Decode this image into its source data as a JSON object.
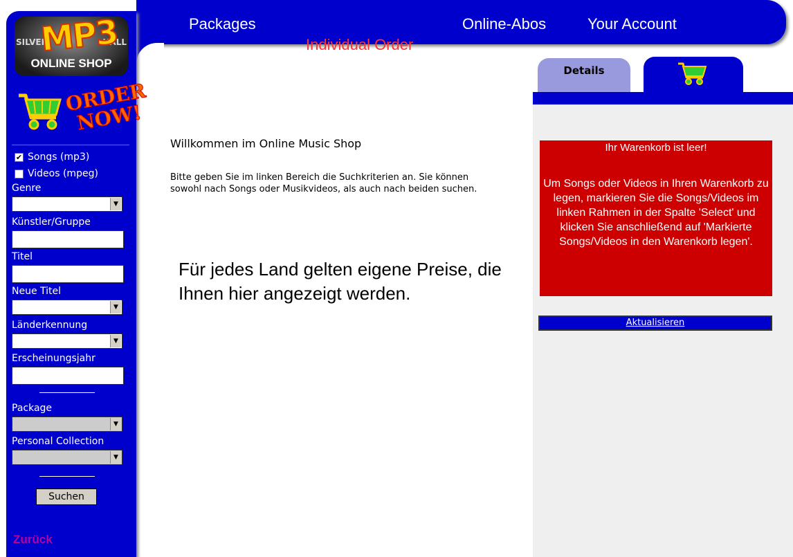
{
  "sidebar": {
    "logo": {
      "brand": "MP3",
      "silver_left": "SILVER",
      "silver_right": "HALL",
      "subtitle": "ONLINE SHOP"
    },
    "order_now": {
      "line1": "ORDER",
      "line2": "NOW!"
    },
    "checkboxes": [
      {
        "label": "Songs (mp3)",
        "checked": true
      },
      {
        "label": "Videos (mpeg)",
        "checked": false
      }
    ],
    "fields": {
      "genre": "Genre",
      "artist": "Künstler/Gruppe",
      "title": "Titel",
      "new_titles": "Neue Titel",
      "country_code": "Länderkennung",
      "release_year": "Erscheinungsjahr",
      "package": "Package",
      "personal_collection": "Personal Collection"
    },
    "search_button": "Suchen",
    "back_link": "Zurück"
  },
  "nav": {
    "packages": "Packages",
    "individual_order": "Individual Order",
    "online_abos": "Online-Abos",
    "your_account": "Your Account"
  },
  "main": {
    "welcome": "Willkommen im Online Music Shop",
    "intro": "Bitte geben Sie im linken Bereich die Suchkriterien an. Sie können sowohl nach Songs oder Musikvideos, als auch nach beiden suchen.",
    "price_note": "Für jedes Land gelten eigene Preise, die Ihnen hier angezeigt werden."
  },
  "cart": {
    "tab_details": "Details",
    "empty_title": "Ihr Warenkorb ist leer!",
    "instructions": "Um Songs oder Videos in Ihren Warenkorb zu legen, markieren Sie die Songs/Videos im linken Rahmen in der Spalte 'Select' und klicken Sie anschließend auf 'Markierte Songs/Videos in den Warenkorb legen'.",
    "refresh": "Aktualisieren"
  },
  "colors": {
    "primary_blue": "#0000cc",
    "cart_alert": "#cc0000",
    "tab_inactive": "#9999dd",
    "accent_red": "#ff3333"
  }
}
